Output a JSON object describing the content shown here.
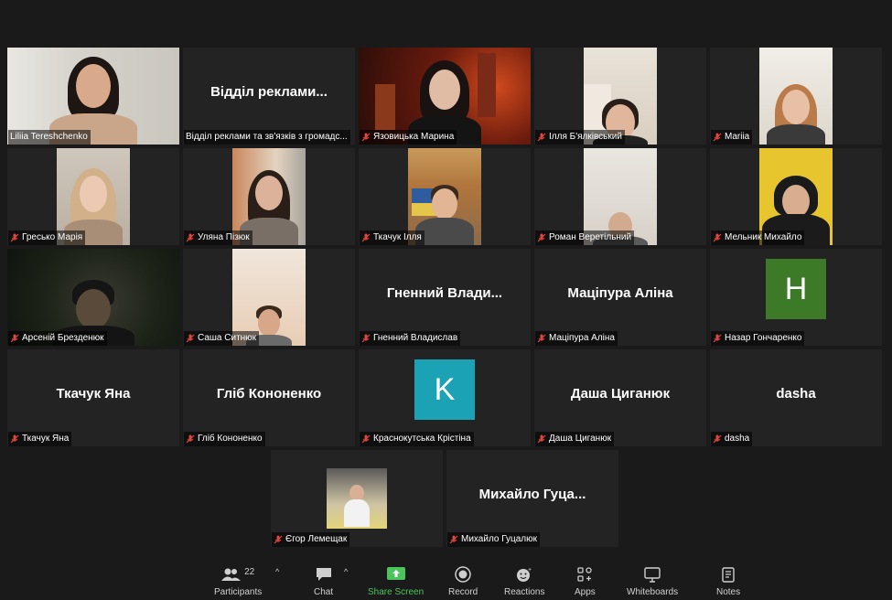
{
  "participants": [
    {
      "name": "Liliia Tereshchenko",
      "label": "Liliia Tereshchenko",
      "type": "video",
      "muted": false
    },
    {
      "name": "Відділ реклами...",
      "label": "Відділ реклами та зв'язків з громадс...",
      "type": "name",
      "muted": false
    },
    {
      "name": "Язовицька Марина",
      "label": "Язовицька Марина",
      "type": "video",
      "muted": true
    },
    {
      "name": "Ілля Б'ялківський",
      "label": "Ілля Б'ялківський",
      "type": "video",
      "muted": true
    },
    {
      "name": "Mariia",
      "label": "Mariia",
      "type": "video",
      "muted": true
    },
    {
      "name": "Гресько Марія",
      "label": "Гресько Марія",
      "type": "video",
      "muted": true
    },
    {
      "name": "Уляна Пізюк",
      "label": "Уляна Пізюк",
      "type": "video",
      "muted": true
    },
    {
      "name": "Ткачук Ілля",
      "label": "Ткачук Ілля",
      "type": "video",
      "muted": true
    },
    {
      "name": "Роман Веретільний",
      "label": "Роман Веретільний",
      "type": "video",
      "muted": true
    },
    {
      "name": "Мельник Михайло",
      "label": "Мельник Михайло",
      "type": "video",
      "muted": true
    },
    {
      "name": "Арсеній Брезденюк",
      "label": "Арсеній Брезденюк",
      "type": "video",
      "muted": true
    },
    {
      "name": "Саша Ситнюк",
      "label": "Саша Ситнюк",
      "type": "video",
      "muted": true
    },
    {
      "name": "Гненний Влади...",
      "label": "Гненний Владислав",
      "type": "name",
      "muted": true
    },
    {
      "name": "Маціпура Аліна",
      "label": "Маціпура Аліна",
      "type": "name",
      "muted": true
    },
    {
      "name": "Н",
      "label": "Назар Гончаренко",
      "type": "avatar",
      "avatar_color": "#3c7a28",
      "muted": true
    },
    {
      "name": "Ткачук Яна",
      "label": "Ткачук Яна",
      "type": "name",
      "muted": true
    },
    {
      "name": "Гліб Кононенко",
      "label": "Гліб Кононенко",
      "type": "name",
      "muted": true
    },
    {
      "name": "K",
      "label": "Краснокутська Крістіна",
      "type": "avatar",
      "avatar_color": "#1ba3b5",
      "muted": true
    },
    {
      "name": "Даша Циганюк",
      "label": "Даша Циганюк",
      "type": "name",
      "muted": true
    },
    {
      "name": "dasha",
      "label": "dasha",
      "type": "name",
      "muted": true
    },
    {
      "name": "Єгор Лемещак",
      "label": "Єгор Лемещак",
      "type": "video",
      "muted": true
    },
    {
      "name": "Михайло Гуца...",
      "label": "Михайло Гуцалюк",
      "type": "name",
      "muted": true
    }
  ],
  "toolbar": {
    "participants_label": "Participants",
    "participants_count": "22",
    "chat_label": "Chat",
    "share_label": "Share Screen",
    "record_label": "Record",
    "reactions_label": "Reactions",
    "apps_label": "Apps",
    "whiteboards_label": "Whiteboards",
    "notes_label": "Notes"
  },
  "colors": {
    "active_speaker_border": "#a6d84a",
    "share_green": "#4cc45c",
    "muted_red": "#e0463c"
  }
}
